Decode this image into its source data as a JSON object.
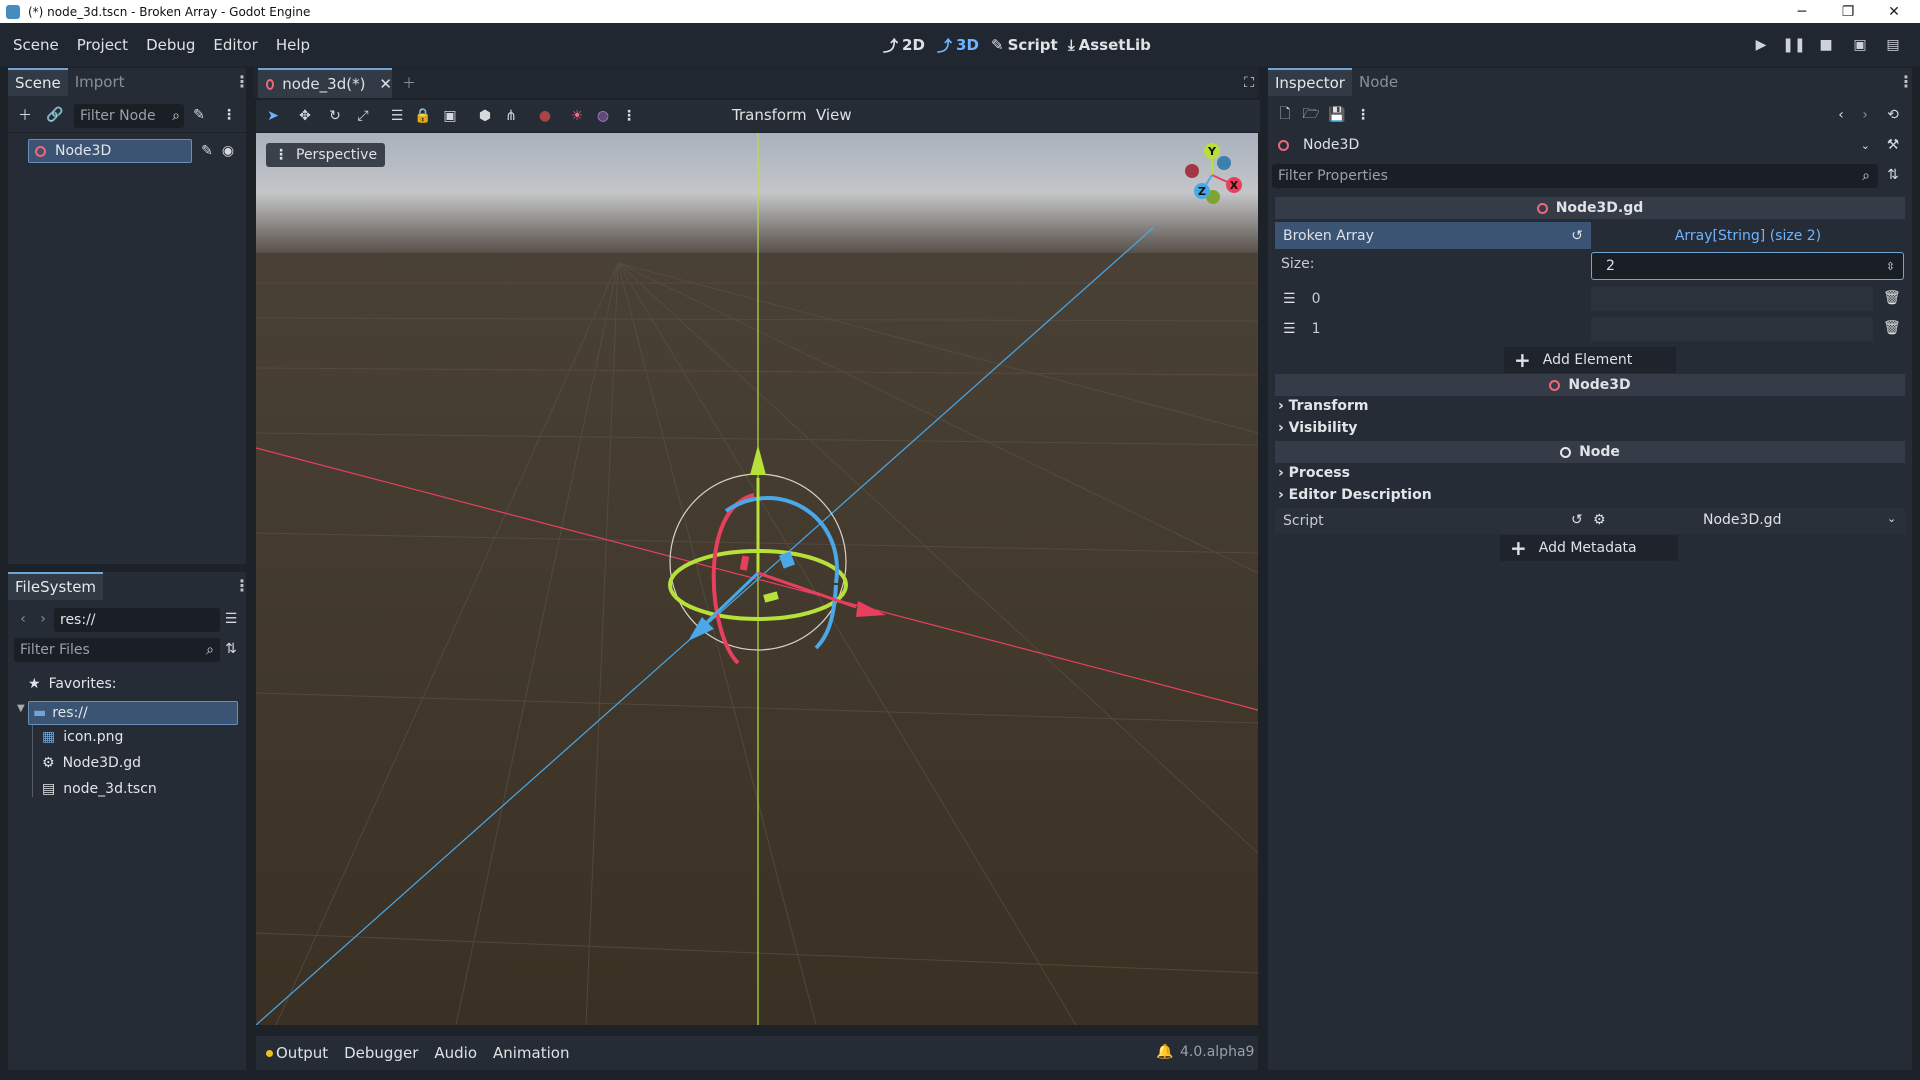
{
  "window": {
    "title": "(*) node_3d.tscn - Broken Array - Godot Engine",
    "min": "─",
    "max": "❐",
    "close": "✕"
  },
  "menu": [
    "Scene",
    "Project",
    "Debug",
    "Editor",
    "Help"
  ],
  "workspaces": {
    "w2d": "2D",
    "w3d": "3D",
    "script": "Script",
    "assetlib": "AssetLib"
  },
  "scene_dock": {
    "tabs": [
      "Scene",
      "Import"
    ],
    "filter_placeholder": "Filter Node",
    "root_node": "Node3D"
  },
  "filesystem": {
    "tab": "FileSystem",
    "path": "res://",
    "filter_placeholder": "Filter Files",
    "favorites": "Favorites:",
    "root": "res://",
    "files": [
      "icon.png",
      "Node3D.gd",
      "node_3d.tscn"
    ]
  },
  "viewport": {
    "scene_tab": "node_3d(*)",
    "menus": [
      "Transform",
      "View"
    ],
    "perspective": "Perspective",
    "gizmo": {
      "y": "Y",
      "x": "X",
      "z": "Z"
    }
  },
  "bottom": {
    "tabs": [
      "Output",
      "Debugger",
      "Audio",
      "Animation"
    ],
    "version": "4.0.alpha9"
  },
  "inspector": {
    "tabs": [
      "Inspector",
      "Node"
    ],
    "object": "Node3D",
    "filter_placeholder": "Filter Properties",
    "script_section": "Node3D.gd",
    "array_prop": "Broken Array",
    "array_value": "Array[String] (size 2)",
    "size_label": "Size:",
    "size_value": "2",
    "elements": [
      "0",
      "1"
    ],
    "add_element": "Add Element",
    "node3d_section": "Node3D",
    "groups1": [
      "Transform",
      "Visibility"
    ],
    "node_section": "Node",
    "groups2": [
      "Process",
      "Editor Description"
    ],
    "script_label": "Script",
    "script_value": "Node3D.gd",
    "add_metadata": "Add Metadata"
  }
}
